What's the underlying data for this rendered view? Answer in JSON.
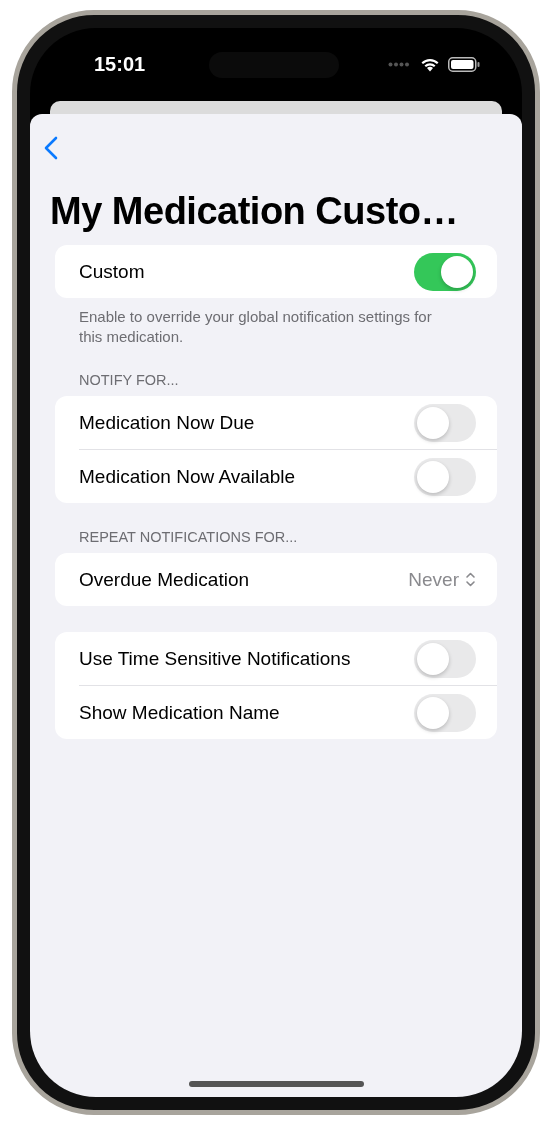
{
  "status_bar": {
    "time": "15:01"
  },
  "title": "My Medication Custo…",
  "sections": [
    {
      "footer": "Enable to override your global notification settings for this medication.",
      "rows": [
        {
          "kind": "toggle",
          "label": "Custom",
          "on": true
        }
      ]
    },
    {
      "header": "NOTIFY FOR...",
      "rows": [
        {
          "kind": "toggle",
          "label": "Medication Now Due",
          "on": false
        },
        {
          "kind": "toggle",
          "label": "Medication Now Available",
          "on": false
        }
      ]
    },
    {
      "header": "REPEAT NOTIFICATIONS FOR...",
      "rows": [
        {
          "kind": "picker",
          "label": "Overdue Medication",
          "value": "Never"
        }
      ]
    },
    {
      "rows": [
        {
          "kind": "toggle",
          "label": "Use Time Sensitive Notifications",
          "on": false
        },
        {
          "kind": "toggle",
          "label": "Show Medication Name",
          "on": false
        }
      ]
    }
  ]
}
